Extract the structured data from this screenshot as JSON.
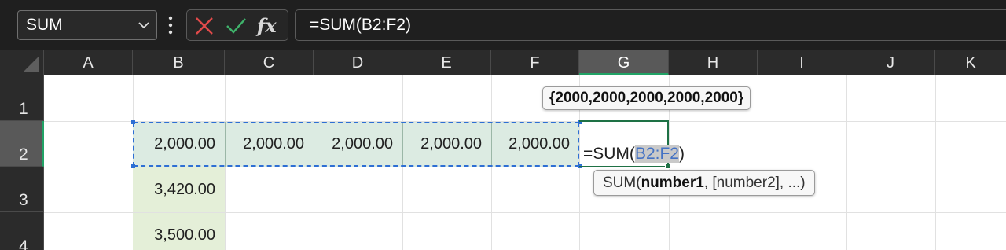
{
  "name_box": {
    "value": "SUM"
  },
  "formula_bar": {
    "value": "=SUM(B2:F2)",
    "cancel_icon": "close-icon",
    "enter_icon": "checkmark-icon",
    "fx_label": "fx"
  },
  "columns": [
    "A",
    "B",
    "C",
    "D",
    "E",
    "F",
    "G",
    "H",
    "I",
    "J",
    "K"
  ],
  "selected_column": "G",
  "rows": [
    "1",
    "2",
    "3",
    "4"
  ],
  "selected_row": "2",
  "cells": {
    "B2": "2,000.00",
    "C2": "2,000.00",
    "D2": "2,000.00",
    "E2": "2,000.00",
    "F2": "2,000.00",
    "B3": "3,420.00",
    "B4": "3,500.00"
  },
  "editing_cell": {
    "prefix": "=SUM(",
    "reference": "B2:F2",
    "suffix": ")"
  },
  "value_tooltip": {
    "text": "{2000,2000,2000,2000,2000}"
  },
  "args_tooltip": {
    "fn": "SUM(",
    "arg1": "number1",
    "rest": ", [number2], ...)"
  },
  "colors": {
    "accent_green": "#1e7145",
    "range_blue": "#2e6fd4",
    "cancel_red": "#e04a4a",
    "enter_green": "#3fb36b"
  }
}
